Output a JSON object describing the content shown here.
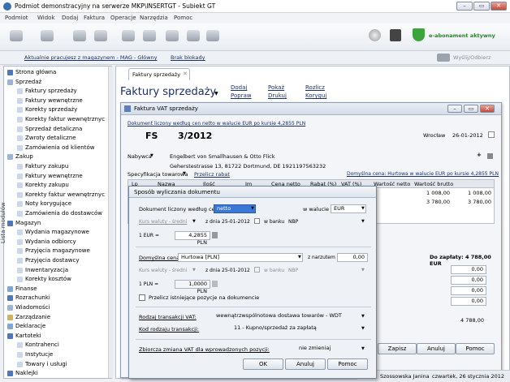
{
  "window": {
    "title": "Podmiot demonstracyjny na serwerze MKP\\INSERTGT - Subiekt GT"
  },
  "menu": [
    "Podmiot",
    "Widok",
    "Dodaj",
    "Faktura",
    "Operacje",
    "Narzędzia",
    "Pomoc"
  ],
  "toolbar": {
    "eabonament": "e-abonament aktywny"
  },
  "context": {
    "warehouse": "Aktualnie pracujesz z magazynem - MAG - Główny",
    "locks": "Brak blokady",
    "send": "Wyślij/Odbierz"
  },
  "sidebar": {
    "vertical_label": "Lista modułów",
    "items": [
      {
        "label": "Strona główna",
        "level": 0
      },
      {
        "label": "Sprzedaż",
        "level": 0
      },
      {
        "label": "Faktury sprzedaży",
        "level": 1
      },
      {
        "label": "Faktury wewnętrzne",
        "level": 1
      },
      {
        "label": "Korekty sprzedaży",
        "level": 1
      },
      {
        "label": "Korekty faktur wewnętrznych",
        "level": 1
      },
      {
        "label": "Sprzedaż detaliczna",
        "level": 1
      },
      {
        "label": "Zwroty detaliczne",
        "level": 1
      },
      {
        "label": "Zamówienia od klientów",
        "level": 1
      },
      {
        "label": "Zakup",
        "level": 0
      },
      {
        "label": "Faktury zakupu",
        "level": 1
      },
      {
        "label": "Faktury wewnętrzne",
        "level": 1
      },
      {
        "label": "Korekty zakupu",
        "level": 1
      },
      {
        "label": "Korekty faktur wewnętrznych",
        "level": 1
      },
      {
        "label": "Noty korygujące",
        "level": 1
      },
      {
        "label": "Zamówienia do dostawców",
        "level": 1
      },
      {
        "label": "Magazyn",
        "level": 0
      },
      {
        "label": "Wydania magazynowe",
        "level": 1
      },
      {
        "label": "Wydania odbiorcy",
        "level": 1
      },
      {
        "label": "Przyjęcia magazynowe",
        "level": 1
      },
      {
        "label": "Przyjęcia dostawcy",
        "level": 1
      },
      {
        "label": "Inwentaryzacja",
        "level": 1
      },
      {
        "label": "Korekty kosztów",
        "level": 1
      },
      {
        "label": "Finanse",
        "level": 0
      },
      {
        "label": "Rozrachunki",
        "level": 0
      },
      {
        "label": "Wiadomości",
        "level": 0
      },
      {
        "label": "Zarządzanie",
        "level": 0
      },
      {
        "label": "Deklaracje",
        "level": 0
      },
      {
        "label": "Kartoteki",
        "level": 0
      },
      {
        "label": "Kontrahenci",
        "level": 1
      },
      {
        "label": "Instytucje",
        "level": 1
      },
      {
        "label": "Towary i usługi",
        "level": 1
      },
      {
        "label": "Naklejki",
        "level": 0
      }
    ]
  },
  "main": {
    "tab": "Faktury sprzedaży",
    "heading": "Faktury sprzedaży",
    "actions": [
      "Dodaj",
      "Popraw",
      "Pokaż",
      "Drukuj",
      "Rozlicz",
      "Koryguj"
    ]
  },
  "invoice": {
    "title": "Faktura VAT sprzedaży",
    "currency_note": "Dokument liczony według cen netto w walucie EUR po kursie 4,2855 PLN",
    "type": "FS",
    "number": "3/2012",
    "city": "Wrocław",
    "date": "26-01-2012",
    "buyer_label": "Nabywca",
    "buyer_name": "Engelbert von Smallhausen & Otto Flick",
    "buyer_address": "Geherstestrasse 13, 81722 Dortmund, DE 1921197563232",
    "spec_label": "Specyfikacja towarowa",
    "recalc": "Przelicz rabat",
    "default_price": "Domyślna cena: Hurtowa w walucie EUR po kursie 4,2855 PLN",
    "columns": [
      "Lp",
      "Nazwa",
      "Ilość",
      "Jm",
      "Cena netto",
      "Rabat (%)",
      "VAT (%)",
      "Wartość netto",
      "Wartość brutto"
    ],
    "rows": [
      {
        "net": "1 008,00",
        "gross": "1 008,00"
      },
      {
        "net": "3 780,00",
        "gross": "3 780,00"
      }
    ],
    "to_pay": "Do zapłaty: 4 788,00 EUR",
    "side_values": [
      "0,00",
      "0,00",
      "0,00",
      "0,00",
      "4 788,00"
    ],
    "buttons": [
      "Zapisz",
      "Anuluj",
      "Pomoc"
    ]
  },
  "dialog": {
    "title": "Sposób wyliczania dokumentu",
    "doc_by_price_label": "Dokument liczony według cen",
    "doc_by_price_value": "netto",
    "in_currency_label": "w walucie",
    "currency": "EUR",
    "rate_label": "Kurs waluty - średni",
    "from_day": "z dnia",
    "rate_date": "25-01-2012",
    "in_bank": "w banku",
    "bank": "NBP",
    "rate_line_label": "1 EUR =",
    "rate_line_value": "4,2855 PLN",
    "default_price_label": "Domyślna cena:",
    "default_price_value": "Hurtowa [PLN]",
    "markup_label": "z narzutem",
    "markup_value": "0,00",
    "rate2_label": "Kurs waluty - średni",
    "rate2_date": "25-01-2012",
    "bank2": "NBP",
    "pln_label": "1 PLN =",
    "pln_value": "1,0000 PLN",
    "recalc_existing": "Przelicz istniejące pozycje na dokumencie",
    "vat_type_label": "Rodzaj transakcji VAT:",
    "vat_type_value": "wewnątrzwspólnotowa dostawa towarów - WDT",
    "trans_code_label": "Kod rodzaju transakcji:",
    "trans_code_value": "11 - Kupno/sprzedaż za zapłatą",
    "bulk_vat_label": "Zbiorcza zmiana VAT dla wprowadzonych pozycji:",
    "bulk_vat_value": "nie zmieniaj",
    "ok": "OK",
    "cancel": "Anuluj",
    "help": "Pomoc"
  },
  "status": {
    "user": "Szossowska Janina",
    "date": "czwartek, 26 stycznia 2012"
  },
  "colors": {
    "accent": "#1b2f6a",
    "green": "#3aa53a"
  }
}
